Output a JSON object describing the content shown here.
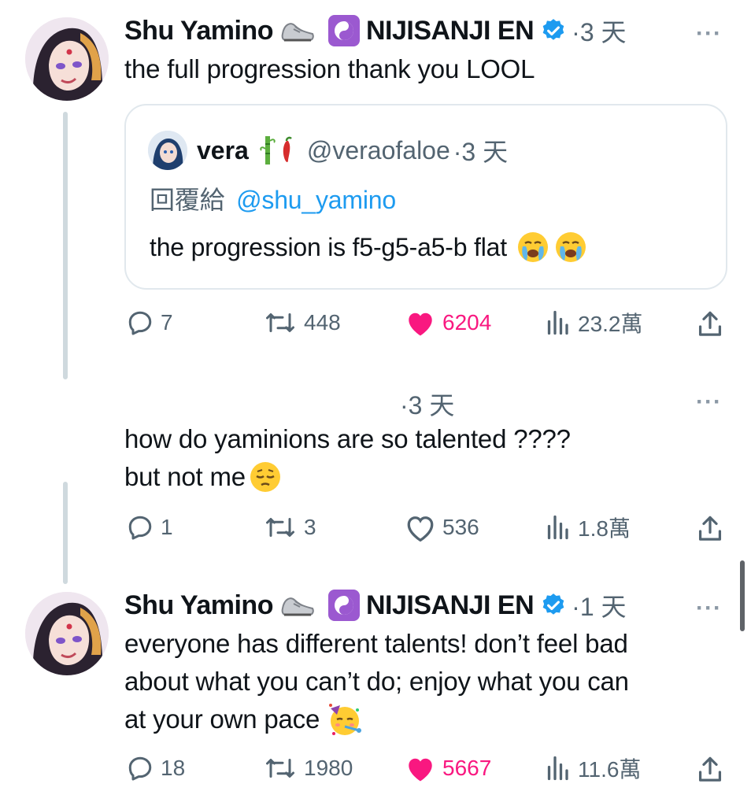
{
  "tweets": [
    {
      "name": "Shu Yamino",
      "affiliation": "NIJISANJI EN",
      "time": "·3 天",
      "more": "···",
      "text": "the full progression thank you LOOL",
      "quote": {
        "name": "vera",
        "handle": "@veraofaloe",
        "time": "·3 天",
        "reply_prefix": "回覆給",
        "reply_to": "@shu_yamino",
        "text": "the progression is f5-g5-a5-b flat"
      },
      "actions": {
        "replies": "7",
        "retweets": "448",
        "likes": "6204",
        "views": "23.2萬"
      },
      "liked": true
    },
    {
      "time": "·3 天",
      "more": "···",
      "text_line1": "how do yaminions are so talented ????",
      "text_line2": "but not me",
      "actions": {
        "replies": "1",
        "retweets": "3",
        "likes": "536",
        "views": "1.8萬"
      },
      "liked": false
    },
    {
      "name": "Shu Yamino",
      "affiliation": "NIJISANJI EN",
      "time": "·1 天",
      "more": "···",
      "text_line1": "everyone has different talents! don’t feel bad",
      "text_line2": "about what you can’t do; enjoy what you can",
      "text_line3": "at your own pace",
      "actions": {
        "replies": "18",
        "retweets": "1980",
        "likes": "5667",
        "views": "11.6萬"
      },
      "liked": true
    }
  ],
  "colors": {
    "like_active": "#f91880",
    "verified": "#1d9bf0",
    "mention": "#1d9bf0",
    "secondary_text": "#536471",
    "thread_line": "#cfd9de"
  },
  "icons": [
    "shoe-emoji",
    "yin-yang-emoji",
    "verified-badge-icon",
    "bamboo-emoji",
    "pepper-emoji",
    "crying-face-emoji",
    "pensive-face-emoji",
    "party-face-emoji",
    "reply-icon",
    "retweet-icon",
    "heart-icon",
    "views-icon",
    "share-icon",
    "more-icon"
  ]
}
